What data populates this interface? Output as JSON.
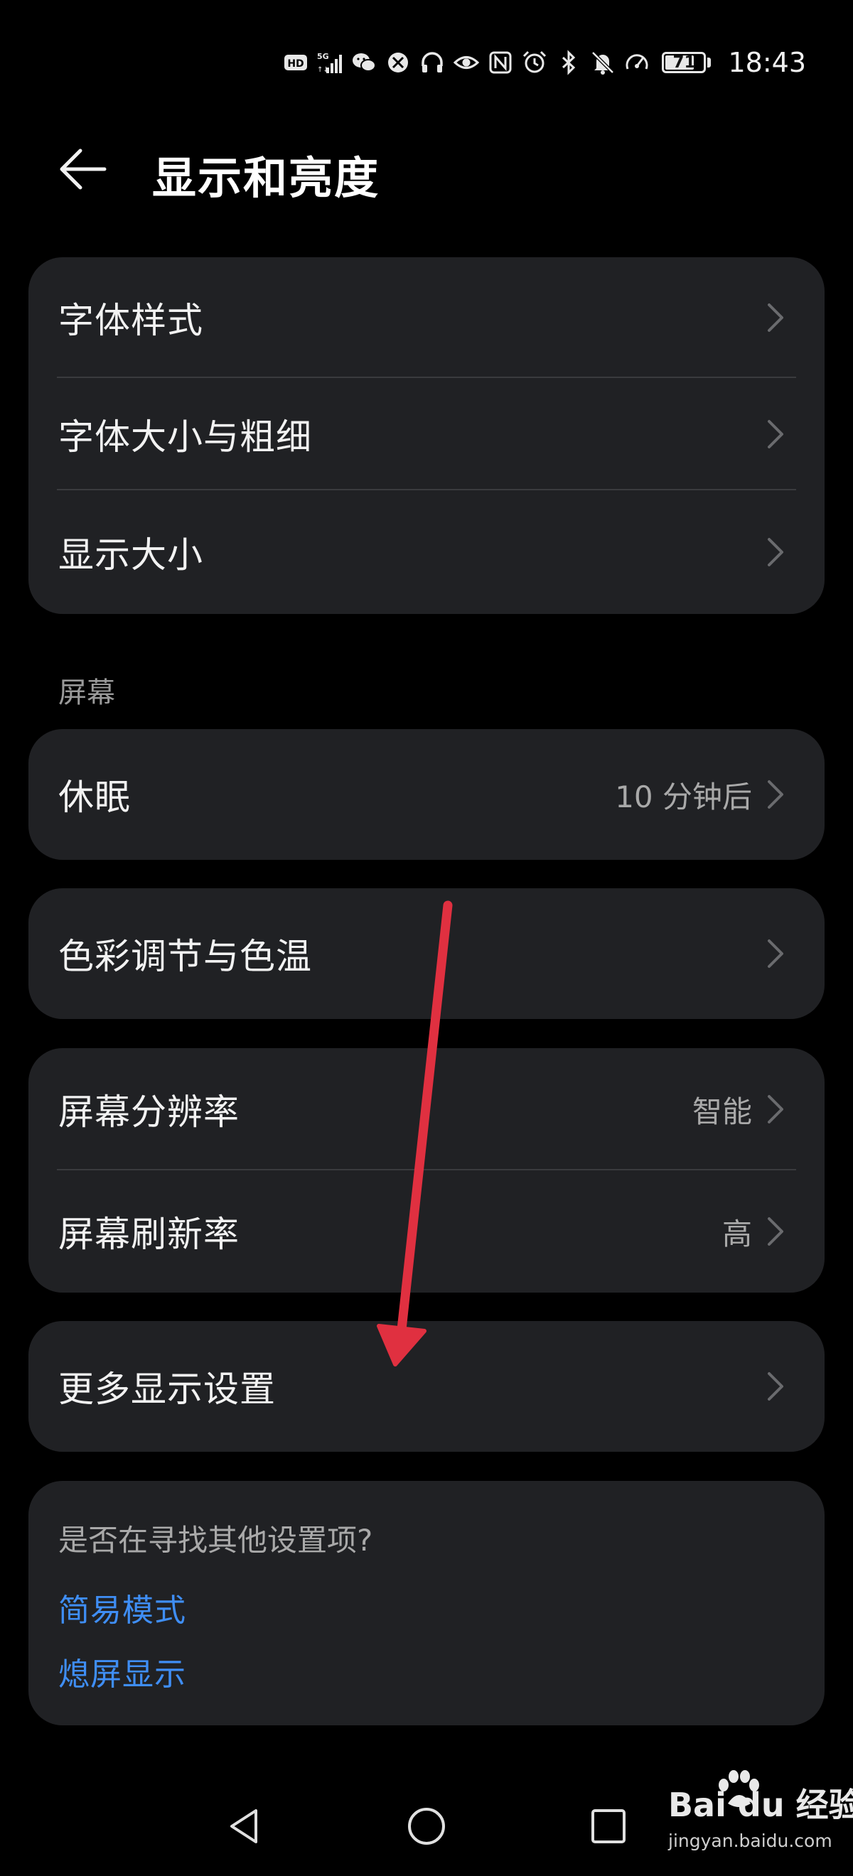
{
  "status_bar": {
    "icons": [
      "hd-icon",
      "5g-signal-icon",
      "wechat-icon",
      "browser-icon",
      "headphones-icon",
      "eye-comfort-icon",
      "nfc-icon",
      "alarm-icon",
      "bluetooth-icon",
      "mute-icon",
      "speed-icon"
    ],
    "battery_level": "71",
    "time": "18:43"
  },
  "header": {
    "title": "显示和亮度"
  },
  "groups": {
    "font": {
      "items": [
        {
          "label": "字体样式"
        },
        {
          "label": "字体大小与粗细"
        },
        {
          "label": "显示大小"
        }
      ]
    },
    "screen_section_label": "屏幕",
    "sleep": {
      "label": "休眠",
      "value": "10 分钟后"
    },
    "color": {
      "label": "色彩调节与色温"
    },
    "resolution": {
      "items": [
        {
          "label": "屏幕分辨率",
          "value": "智能"
        },
        {
          "label": "屏幕刷新率",
          "value": "高"
        }
      ]
    },
    "more": {
      "label": "更多显示设置"
    }
  },
  "hint_card": {
    "title": "是否在寻找其他设置项?",
    "links": [
      "简易模式",
      "熄屏显示"
    ]
  },
  "watermark": {
    "main": "Bai du 经验",
    "sub": "jingyan.baidu.com"
  },
  "colors": {
    "background": "#000000",
    "card": "#202124",
    "link": "#3f8ef5",
    "annotation_arrow": "#e03040"
  }
}
